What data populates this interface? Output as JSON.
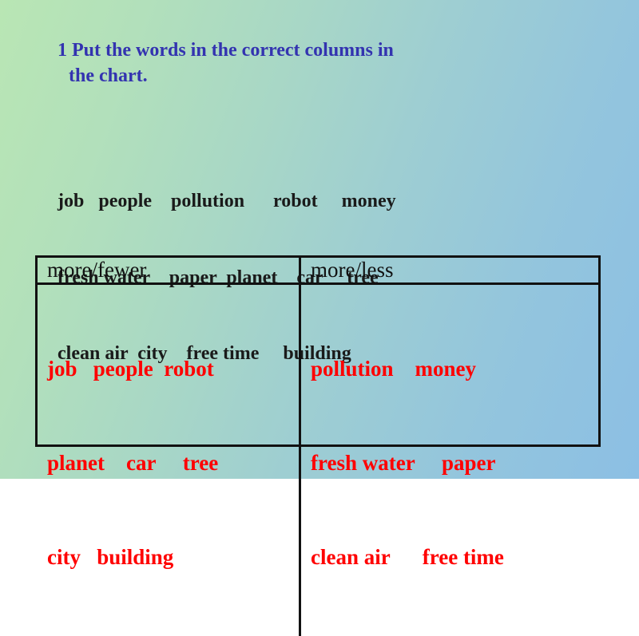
{
  "slide": {
    "heading": {
      "line1": "1 Put the words in the correct columns in",
      "line2": "the chart."
    },
    "wordbank": {
      "line1": "job   people    pollution      robot     money",
      "line2": "fresh water    paper  planet    car     tree",
      "line3": "clean air  city    free time     building"
    },
    "chart": {
      "headers": [
        "more/fewer",
        "more/less"
      ],
      "columns": [
        {
          "header": "more/fewer",
          "lines": [
            "job   people  robot",
            "planet    car     tree",
            "city   building"
          ]
        },
        {
          "header": "more/less",
          "lines": [
            "pollution    money",
            "fresh water     paper",
            "clean air      free time"
          ]
        }
      ]
    },
    "colors": {
      "heading": "#3333b0",
      "wordbank": "#1a1a1a",
      "answers": "#ff0000",
      "border": "#111111"
    }
  }
}
